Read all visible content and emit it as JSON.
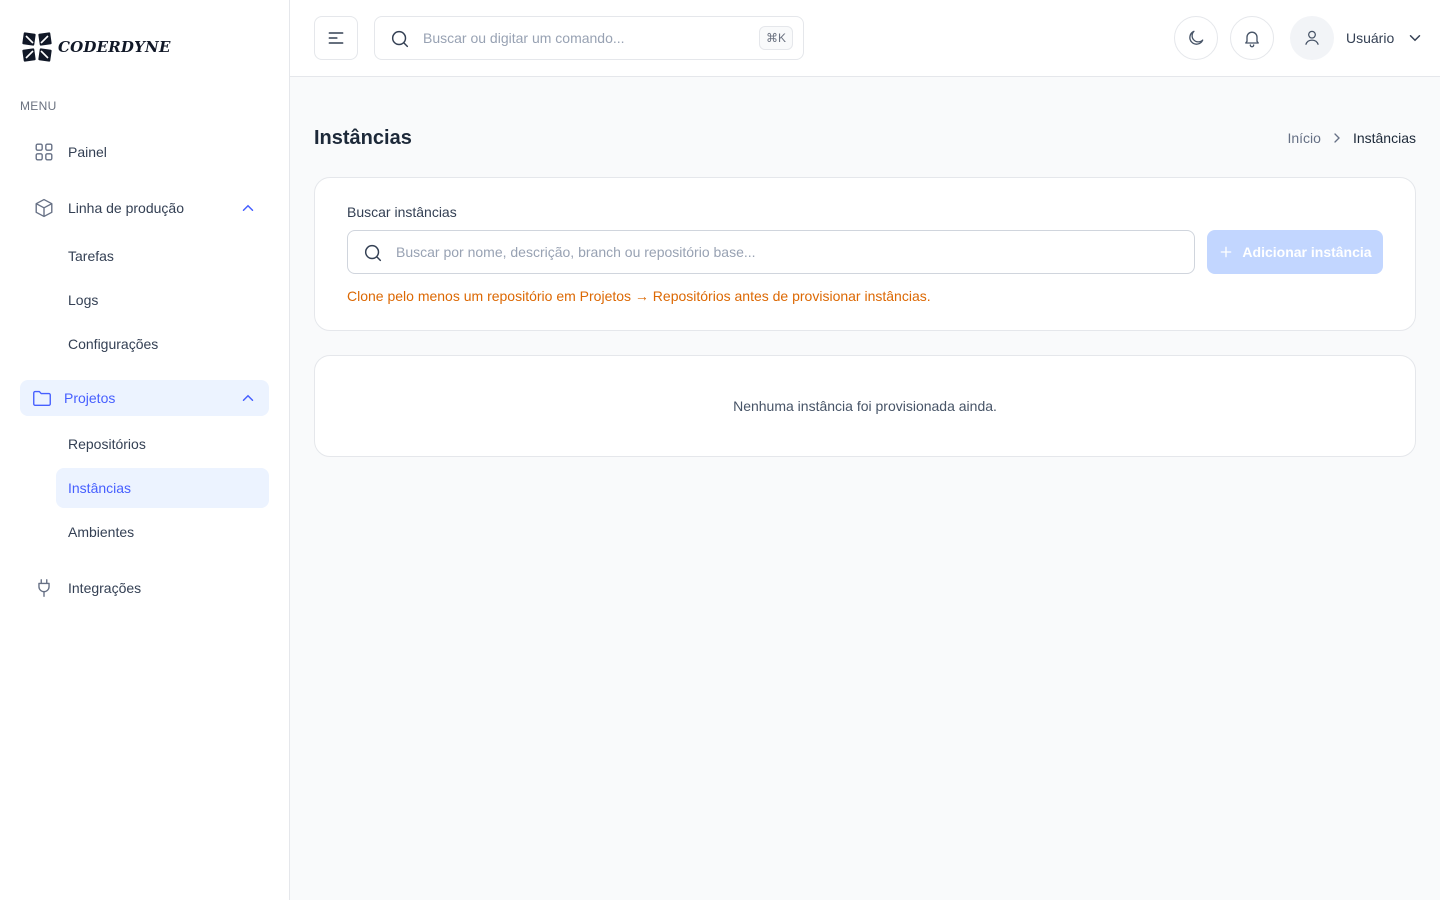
{
  "brand": {
    "name": "CODERDYNE"
  },
  "sidebar": {
    "menu_label": "MENU",
    "items": [
      {
        "label": "Painel",
        "icon": "grid-icon"
      },
      {
        "label": "Linha de produção",
        "icon": "box-icon",
        "expanded": true,
        "children": [
          {
            "label": "Tarefas"
          },
          {
            "label": "Logs"
          },
          {
            "label": "Configurações"
          }
        ]
      },
      {
        "label": "Projetos",
        "icon": "folder-icon",
        "expanded": true,
        "active": true,
        "children": [
          {
            "label": "Repositórios"
          },
          {
            "label": "Instâncias",
            "active": true
          },
          {
            "label": "Ambientes"
          }
        ]
      },
      {
        "label": "Integrações",
        "icon": "plug-icon"
      }
    ]
  },
  "header": {
    "search_placeholder": "Buscar ou digitar um comando...",
    "shortcut": "⌘K",
    "user_name": "Usuário"
  },
  "page": {
    "title": "Instâncias",
    "breadcrumb": {
      "home": "Início",
      "current": "Instâncias"
    }
  },
  "search_card": {
    "label": "Buscar instâncias",
    "placeholder": "Buscar por nome, descrição, branch ou repositório base...",
    "add_button": "Adicionar instância",
    "warning": "Clone pelo menos um repositório em Projetos → Repositórios antes de provisionar instâncias."
  },
  "empty_state": {
    "message": "Nenhuma instância foi provisionada ainda."
  },
  "colors": {
    "accent": "#465fff",
    "accent_bg": "#ecf3ff",
    "warning": "#dc6803",
    "button_disabled": "#c2d6ff"
  }
}
